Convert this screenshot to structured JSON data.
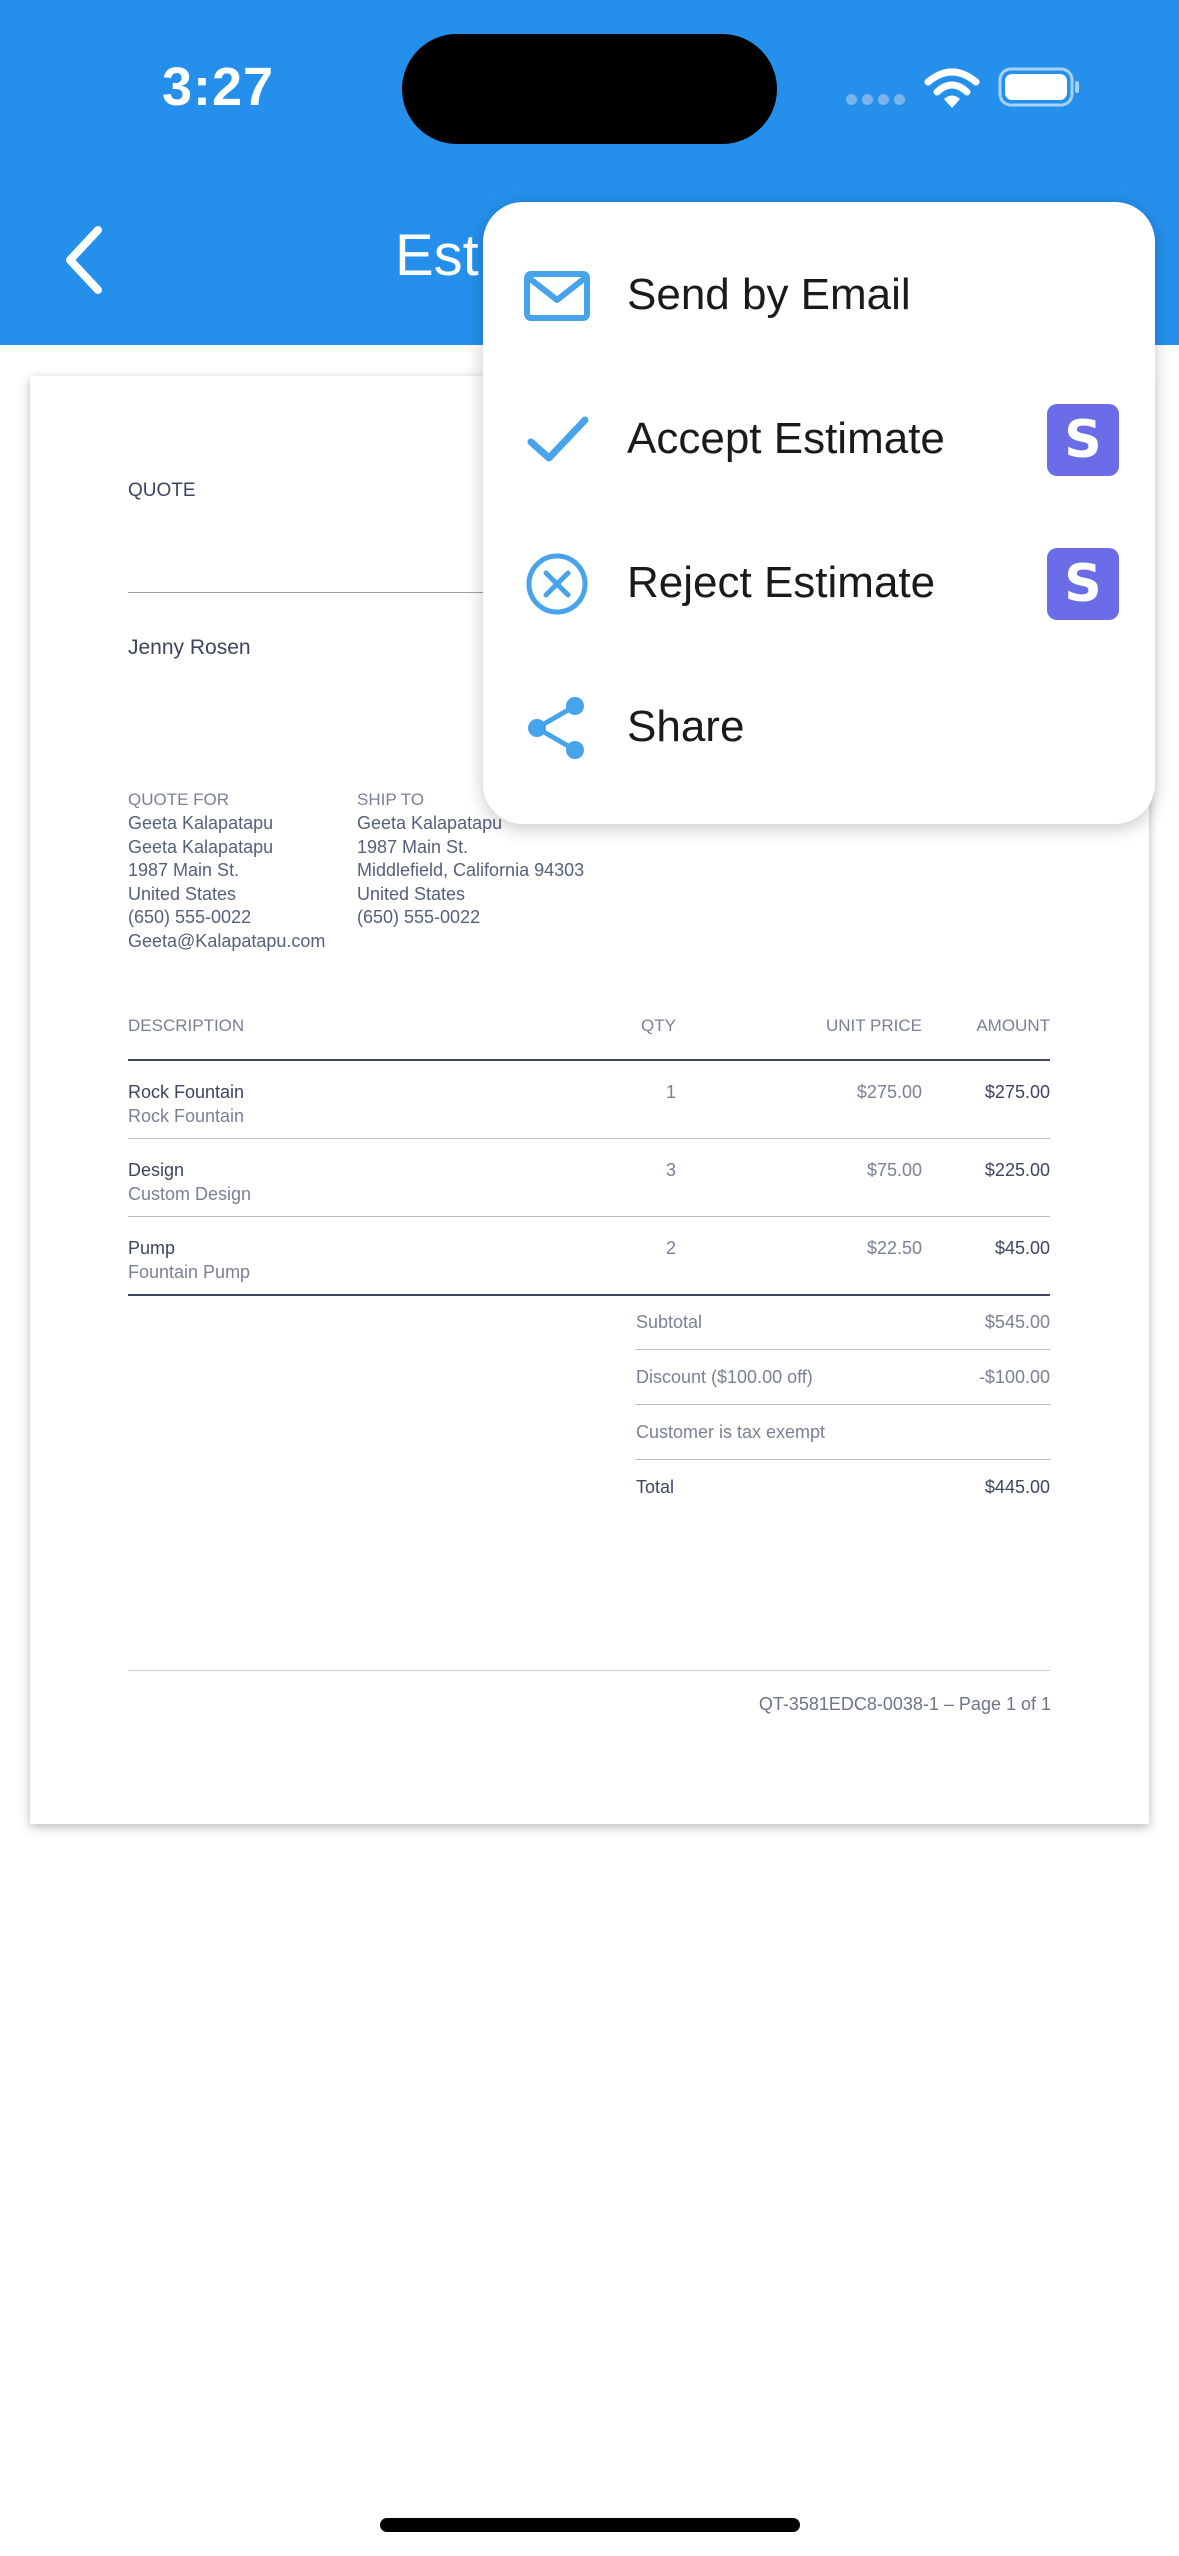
{
  "status_bar": {
    "time": "3:27"
  },
  "nav": {
    "title": "Est"
  },
  "colors": {
    "header": "#2590ec",
    "accent_icon": "#47a3eb",
    "stripe": "#6b6de8"
  },
  "document": {
    "quote_label": "QUOTE",
    "company": "Jenny Rosen",
    "quote_for": {
      "label": "QUOTE FOR",
      "lines": [
        "Geeta Kalapatapu",
        "Geeta Kalapatapu",
        "1987 Main St.",
        "United States",
        "(650) 555-0022",
        "Geeta@Kalapatapu.com"
      ]
    },
    "ship_to": {
      "label": "SHIP TO",
      "lines": [
        "Geeta Kalapatapu",
        "1987 Main St.",
        "Middlefield, California 94303",
        "United States",
        "(650) 555-0022"
      ]
    },
    "table": {
      "headers": {
        "description": "DESCRIPTION",
        "qty": "QTY",
        "unit_price": "UNIT PRICE",
        "amount": "AMOUNT"
      },
      "rows": [
        {
          "name": "Rock Fountain",
          "detail": "Rock Fountain",
          "qty": "1",
          "unit_price": "$275.00",
          "amount": "$275.00"
        },
        {
          "name": "Design",
          "detail": "Custom Design",
          "qty": "3",
          "unit_price": "$75.00",
          "amount": "$225.00"
        },
        {
          "name": "Pump",
          "detail": "Fountain Pump",
          "qty": "2",
          "unit_price": "$22.50",
          "amount": "$45.00"
        }
      ]
    },
    "totals": {
      "subtotal_label": "Subtotal",
      "subtotal": "$545.00",
      "discount_label": "Discount ($100.00 off)",
      "discount": "-$100.00",
      "tax_label": "Customer is tax exempt",
      "total_label": "Total",
      "total": "$445.00"
    },
    "footer": "QT-3581EDC8-0038-1 – Page 1 of 1"
  },
  "menu": {
    "items": [
      {
        "label": "Send by Email",
        "icon": "mail-icon"
      },
      {
        "label": "Accept Estimate",
        "icon": "check-icon",
        "badge": "S"
      },
      {
        "label": "Reject Estimate",
        "icon": "x-circle-icon",
        "badge": "S"
      },
      {
        "label": "Share",
        "icon": "share-icon"
      }
    ]
  }
}
